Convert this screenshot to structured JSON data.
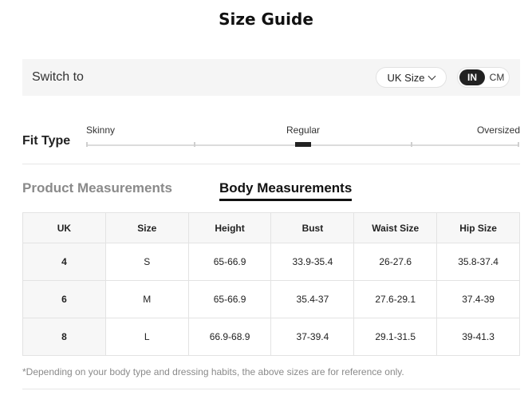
{
  "title": "Size Guide",
  "switch": {
    "label": "Switch to",
    "size_system": "UK Size",
    "units": [
      "IN",
      "CM"
    ],
    "active_unit": "IN"
  },
  "fit": {
    "label": "Fit Type",
    "options": [
      "Skinny",
      "Regular",
      "Oversized"
    ],
    "selected": "Regular"
  },
  "tabs": {
    "product": "Product Measurements",
    "body": "Body Measurements",
    "active": "Body Measurements"
  },
  "table": {
    "headers": [
      "UK",
      "Size",
      "Height",
      "Bust",
      "Waist Size",
      "Hip Size"
    ],
    "rows": [
      [
        "4",
        "S",
        "65-66.9",
        "33.9-35.4",
        "26-27.6",
        "35.8-37.4"
      ],
      [
        "6",
        "M",
        "65-66.9",
        "35.4-37",
        "27.6-29.1",
        "37.4-39"
      ],
      [
        "8",
        "L",
        "66.9-68.9",
        "37-39.4",
        "29.1-31.5",
        "39-41.3"
      ]
    ]
  },
  "note": "*Depending on your body type and dressing habits, the above sizes are for reference only.",
  "colors": {
    "accent": "#222222",
    "muted_text": "#8a8a8a",
    "panel_bg": "#f5f5f5"
  }
}
